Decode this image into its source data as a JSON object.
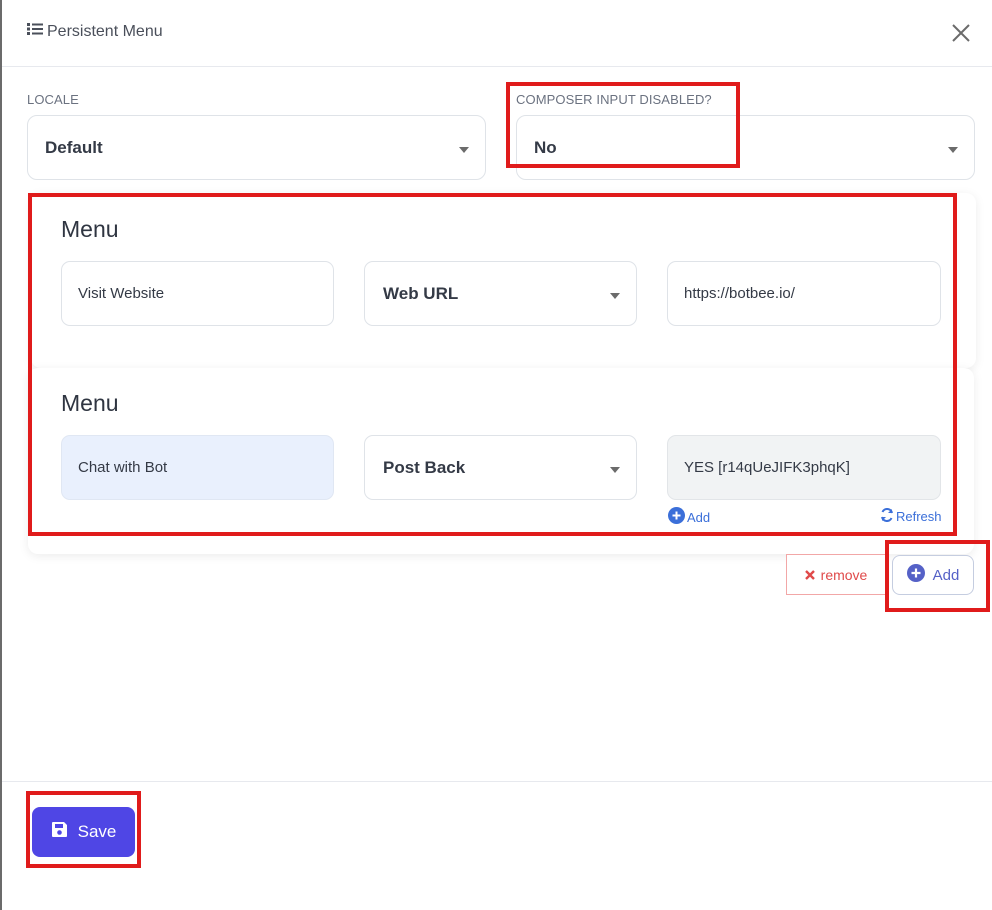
{
  "header": {
    "title": "Persistent Menu"
  },
  "locale": {
    "label": "LOCALE",
    "value": "Default"
  },
  "composer": {
    "label": "COMPOSER INPUT DISABLED?",
    "value": "No"
  },
  "menus": [
    {
      "title": "Menu",
      "button_title": "Visit Website",
      "type": "Web URL",
      "payload": "https://botbee.io/"
    },
    {
      "title": "Menu",
      "button_title": "Chat with Bot",
      "type": "Post Back",
      "payload": "YES [r14qUeJIFK3phqK]",
      "add_label": "Add",
      "refresh_label": "Refresh"
    }
  ],
  "actions": {
    "remove_label": "remove",
    "add_label": "Add"
  },
  "footer": {
    "save_label": "Save"
  },
  "colors": {
    "primary": "#4f46e5",
    "danger": "#e04a4a",
    "annotation": "#e01b1b"
  }
}
